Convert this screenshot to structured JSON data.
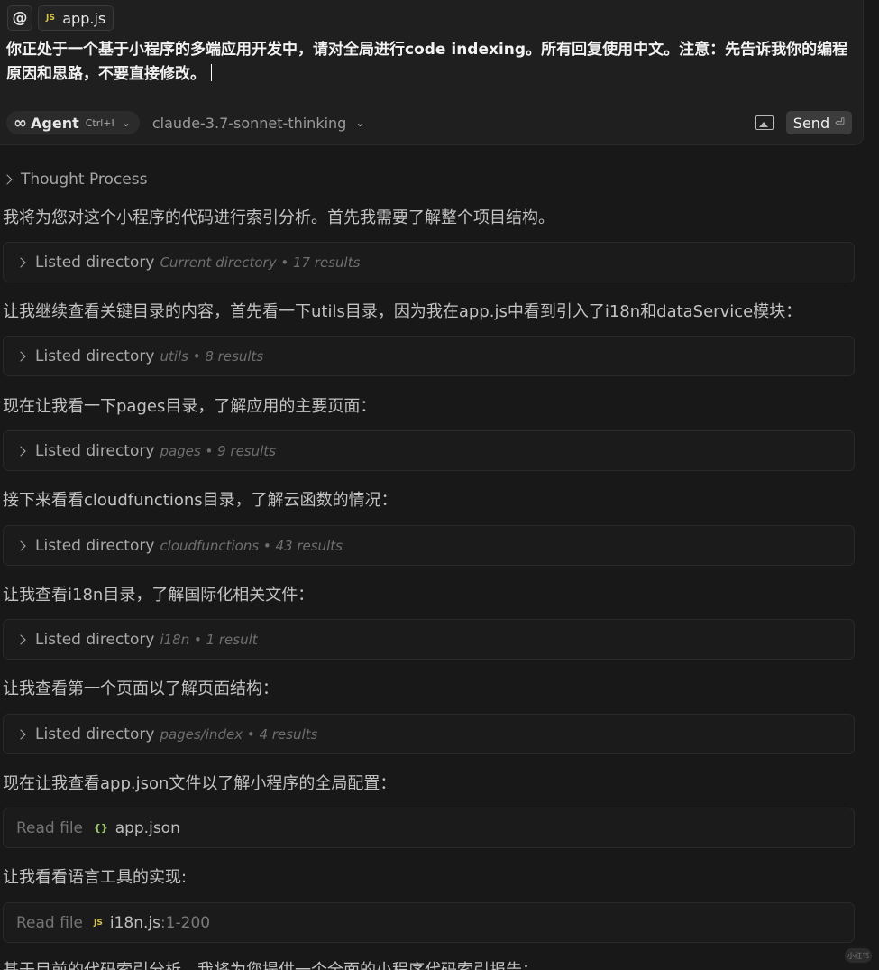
{
  "composer": {
    "at_symbol": "@",
    "context_file": {
      "badge": "JS",
      "name": "app.js"
    },
    "prompt_text": "你正处于一个基于小程序的多端应用开发中，请对全局进行code indexing。所有回复使用中文。注意：先告诉我你的编程原因和思路，不要直接修改。",
    "agent": {
      "label": "Agent",
      "shortcut": "Ctrl+I",
      "icon": "infinity-icon"
    },
    "model": "claude-3.7-sonnet-thinking",
    "send_label": "Send",
    "send_shortcut": "⏎"
  },
  "conversation": {
    "thought_label": "Thought Process",
    "messages": [
      "我将为您对这个小程序的代码进行索引分析。首先我需要了解整个项目结构。",
      "让我继续查看关键目录的内容，首先看一下utils目录，因为我在app.js中看到引入了i18n和dataService模块：",
      "现在让我看一下pages目录，了解应用的主要页面：",
      "接下来看看cloudfunctions目录，了解云函数的情况：",
      "让我查看i18n目录，了解国际化相关文件：",
      "让我查看第一个页面以了解页面结构：",
      "现在让我查看app.json文件以了解小程序的全局配置：",
      "让我看看语言工具的实现:",
      "基于目前的代码索引分析，我将为您提供一个全面的小程序代码索引报告："
    ],
    "tool_calls": [
      {
        "title": "Listed directory",
        "detail": "Current directory • 17 results"
      },
      {
        "title": "Listed directory",
        "detail": "utils • 8 results"
      },
      {
        "title": "Listed directory",
        "detail": "pages • 9 results"
      },
      {
        "title": "Listed directory",
        "detail": "cloudfunctions • 43 results"
      },
      {
        "title": "Listed directory",
        "detail": "i18n • 1 result"
      },
      {
        "title": "Listed directory",
        "detail": "pages/index • 4 results"
      }
    ],
    "read_files": [
      {
        "label": "Read file",
        "icon": "{}",
        "file": "app.json",
        "range": ""
      },
      {
        "label": "Read file",
        "icon": "JS",
        "file": "i18n.js",
        "range": ":1-200"
      }
    ]
  },
  "watermark": "小红书"
}
